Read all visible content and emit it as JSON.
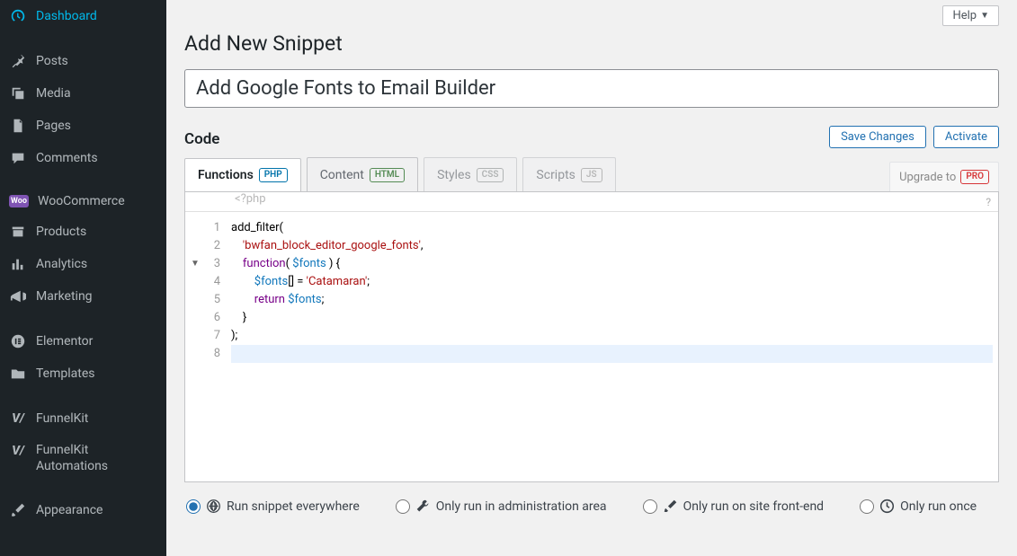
{
  "sidebar": {
    "items": [
      {
        "label": "Dashboard"
      },
      {
        "label": "Posts"
      },
      {
        "label": "Media"
      },
      {
        "label": "Pages"
      },
      {
        "label": "Comments"
      },
      {
        "label": "WooCommerce"
      },
      {
        "label": "Products"
      },
      {
        "label": "Analytics"
      },
      {
        "label": "Marketing"
      },
      {
        "label": "Elementor"
      },
      {
        "label": "Templates"
      },
      {
        "label": "FunnelKit"
      },
      {
        "label": "FunnelKit Automations"
      },
      {
        "label": "Appearance"
      }
    ]
  },
  "header": {
    "help_label": "Help",
    "page_title": "Add New Snippet",
    "snippet_title": "Add Google Fonts to Email Builder"
  },
  "actions": {
    "section_label": "Code",
    "save_label": "Save Changes",
    "activate_label": "Activate"
  },
  "tabs": {
    "functions": {
      "label": "Functions",
      "tag": "PHP"
    },
    "content": {
      "label": "Content",
      "tag": "HTML"
    },
    "styles": {
      "label": "Styles",
      "tag": "CSS"
    },
    "scripts": {
      "label": "Scripts",
      "tag": "JS"
    },
    "upgrade_prefix": "Upgrade to",
    "upgrade_tag": "PRO"
  },
  "editor": {
    "prologue": "<?php",
    "help_char": "?",
    "line_numbers": [
      "1",
      "2",
      "3",
      "4",
      "5",
      "6",
      "7",
      "8"
    ],
    "code_lines": [
      {
        "tokens": [
          {
            "t": "add_filter",
            "c": "k-fn"
          },
          {
            "t": "(",
            "c": "k-punc"
          }
        ]
      },
      {
        "indent": 1,
        "tokens": [
          {
            "t": "'bwfan_block_editor_google_fonts'",
            "c": "k-str"
          },
          {
            "t": ",",
            "c": "k-punc"
          }
        ]
      },
      {
        "indent": 1,
        "tokens": [
          {
            "t": "function",
            "c": "k-kw"
          },
          {
            "t": "( ",
            "c": "k-punc"
          },
          {
            "t": "$fonts",
            "c": "k-var"
          },
          {
            "t": " ) {",
            "c": "k-punc"
          }
        ]
      },
      {
        "indent": 2,
        "tokens": [
          {
            "t": "$fonts",
            "c": "k-var"
          },
          {
            "t": "[] = ",
            "c": "k-op"
          },
          {
            "t": "'Catamaran'",
            "c": "k-str"
          },
          {
            "t": ";",
            "c": "k-punc"
          }
        ]
      },
      {
        "indent": 2,
        "tokens": [
          {
            "t": "return",
            "c": "k-kw"
          },
          {
            "t": " ",
            "c": ""
          },
          {
            "t": "$fonts",
            "c": "k-var"
          },
          {
            "t": ";",
            "c": "k-punc"
          }
        ]
      },
      {
        "indent": 1,
        "tokens": [
          {
            "t": "}",
            "c": "k-punc"
          }
        ]
      },
      {
        "tokens": [
          {
            "t": ");",
            "c": "k-punc"
          }
        ]
      },
      {
        "hl": true,
        "tokens": []
      }
    ]
  },
  "run_options": [
    {
      "label": "Run snippet everywhere",
      "checked": true
    },
    {
      "label": "Only run in administration area",
      "checked": false
    },
    {
      "label": "Only run on site front-end",
      "checked": false
    },
    {
      "label": "Only run once",
      "checked": false
    }
  ]
}
